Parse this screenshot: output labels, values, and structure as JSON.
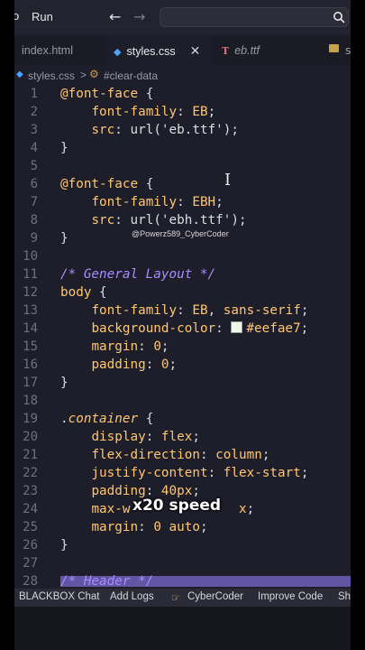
{
  "menubar": {
    "lead": "o",
    "run": "Run",
    "back_icon": "arrow-left-icon",
    "forward_icon": "arrow-right-icon",
    "search_icon": "search-icon"
  },
  "tabs": [
    {
      "label": "index.html",
      "active": false
    },
    {
      "label": "styles.css",
      "active": true,
      "icon": "css-file-icon"
    },
    {
      "label": "eb.ttf",
      "active": false,
      "icon": "font-file-icon"
    },
    {
      "label": "s",
      "active": false,
      "icon": "folder-icon"
    }
  ],
  "breadcrumb": {
    "file": "styles.css",
    "separator": ">",
    "symbol": "#clear-data"
  },
  "editor": {
    "line_numbers": [
      "1",
      "2",
      "3",
      "4",
      "5",
      "6",
      "7",
      "8",
      "9",
      "10",
      "11",
      "12",
      "13",
      "14",
      "15",
      "16",
      "17",
      "18",
      "19",
      "20",
      "21",
      "22",
      "23",
      "24",
      "25",
      "26",
      "27",
      "28"
    ],
    "swatch_color": "#eefae7"
  },
  "status_bar": {
    "items": [
      "BLACKBOX Chat",
      "Add Logs",
      "CyberCoder",
      "Improve Code",
      "Sh"
    ],
    "cybercoder_icon": "hand-pointer-icon"
  },
  "overlay": {
    "watermark": "@Powerz589_CyberCoder",
    "speed": "x20 speed"
  }
}
